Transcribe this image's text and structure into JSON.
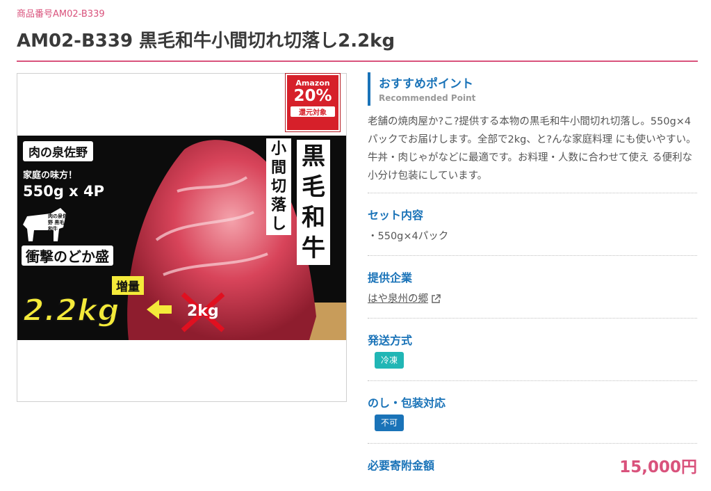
{
  "product": {
    "code_label": "商品番号AM02-B339",
    "title": "AM02-B339 黒毛和牛小間切れ切落し2.2kg"
  },
  "image": {
    "badge_line1": "Amazon",
    "badge_line2": "20%",
    "badge_line3": "還元対象",
    "shop_name": "肉の泉佐野",
    "family_taste": "家庭の味方！",
    "pack_size": "550g x 4P",
    "cow_caption": "肉の泉佐野 黒毛和牛",
    "headline": "衝撃のどか盛",
    "increase": "増量",
    "weight": "2.2kg",
    "old_weight": "2kg",
    "vertical_small": "小間切落し",
    "vertical_big": "黒毛和牛"
  },
  "recommend": {
    "title": "おすすめポイント",
    "subtitle": "Recommended Point",
    "text": "老舗の焼肉屋か?こ?提供する本物の黒毛和牛小間切れ切落し。550g×4パックでお届けします。全部で2kg、と?んな家庭料理 にも使いやすい。牛丼・肉じゃがなどに最適です。お料理・人数に合わせて使え る便利な小分け包装にしています。"
  },
  "set_contents": {
    "heading": "セット内容",
    "text": "・550g×4パック"
  },
  "company": {
    "heading": "提供企業",
    "name": "はや泉州の郷"
  },
  "shipping": {
    "heading": "発送方式",
    "tag": "冷凍"
  },
  "noshi": {
    "heading": "のし・包装対応",
    "tag": "不可"
  },
  "donation": {
    "heading": "必要寄附金額",
    "price": "15,000円"
  },
  "colors": {
    "accent_pink": "#d9527c",
    "accent_blue": "#1a73b8",
    "tag_teal": "#21b6b5",
    "tag_blue": "#1a73b8"
  }
}
